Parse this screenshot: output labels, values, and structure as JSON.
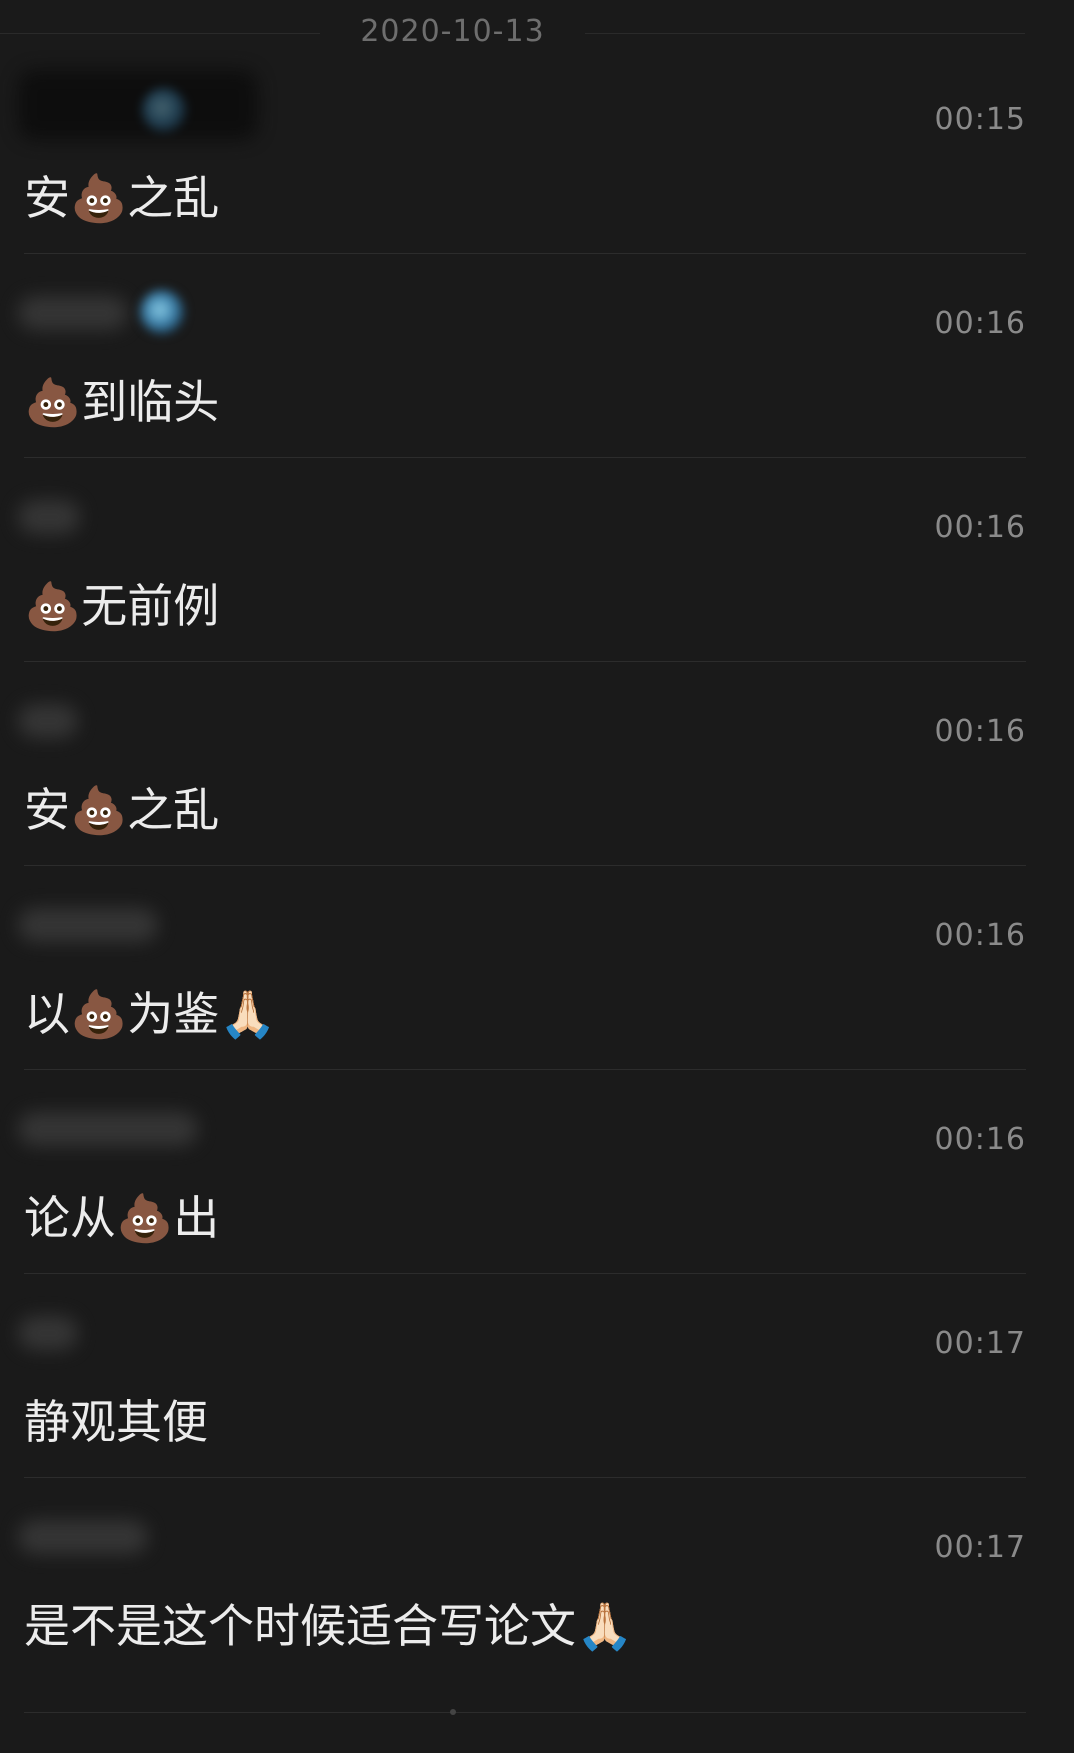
{
  "date_divider": "2020-10-13",
  "messages": [
    {
      "time": "00:15",
      "text": "安💩之乱"
    },
    {
      "time": "00:16",
      "text": "💩到临头"
    },
    {
      "time": "00:16",
      "text": "💩无前例"
    },
    {
      "time": "00:16",
      "text": "安💩之乱"
    },
    {
      "time": "00:16",
      "text": "以💩为鉴🙏🏻"
    },
    {
      "time": "00:16",
      "text": "论从💩出"
    },
    {
      "time": "00:17",
      "text": "静观其便"
    },
    {
      "time": "00:17",
      "text": "是不是这个时候适合写论文🙏🏻"
    }
  ],
  "icons": {
    "sender_name_blurred": "blurred-sender-name",
    "sender_avatar_badge": "blue-globe-badge"
  }
}
